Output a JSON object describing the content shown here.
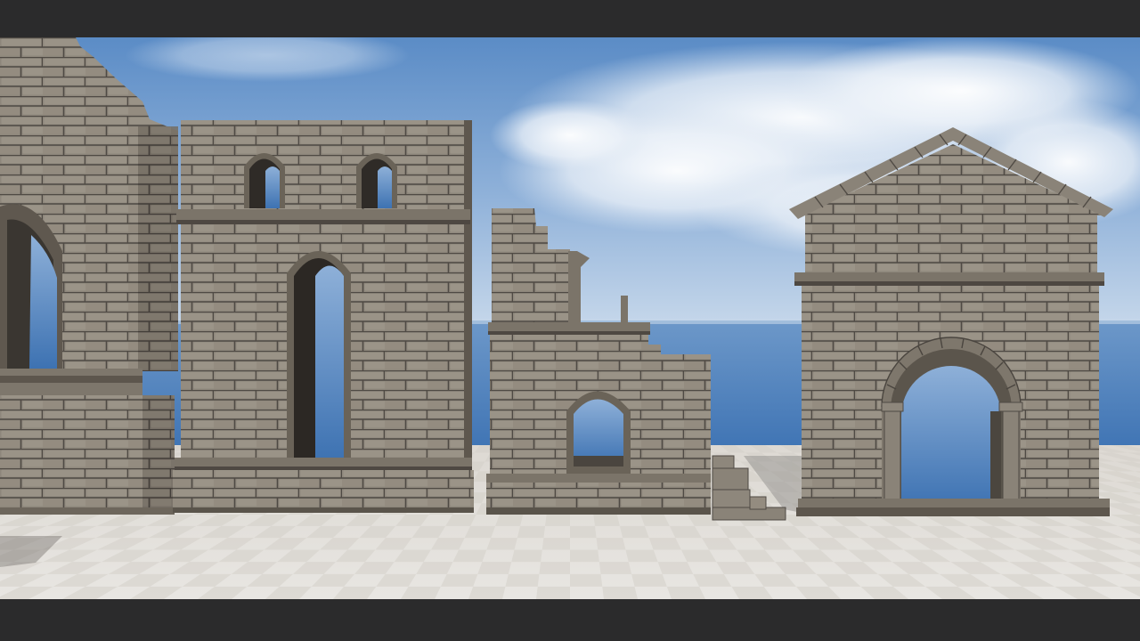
{
  "scene": {
    "kind": "3d-viewport-render",
    "subject": "modular-stone-ruin-walls",
    "colors": {
      "letterbox": "#2b2b2c",
      "sky_top": "#5e8fc7",
      "sky_horizon": "#b9cfe6",
      "sea": "#4c80bd",
      "stone": "#8d8579",
      "stone_dark": "#5f584f",
      "mortar": "#4a4540",
      "floor_light": "#e4e1dc",
      "floor_dark": "#d3cfc9"
    },
    "objects": [
      {
        "id": "left-tower-ruin",
        "has_gothic_arch_opening": true
      },
      {
        "id": "two-story-wall",
        "lancet_windows": 2,
        "tall_arched_door": 1
      },
      {
        "id": "broken-wall",
        "small_arched_window": 1,
        "stepped_ruined_top": true
      },
      {
        "id": "gabled-gatehouse",
        "round_arch_gateway": 1,
        "gable_roof": true
      }
    ]
  }
}
